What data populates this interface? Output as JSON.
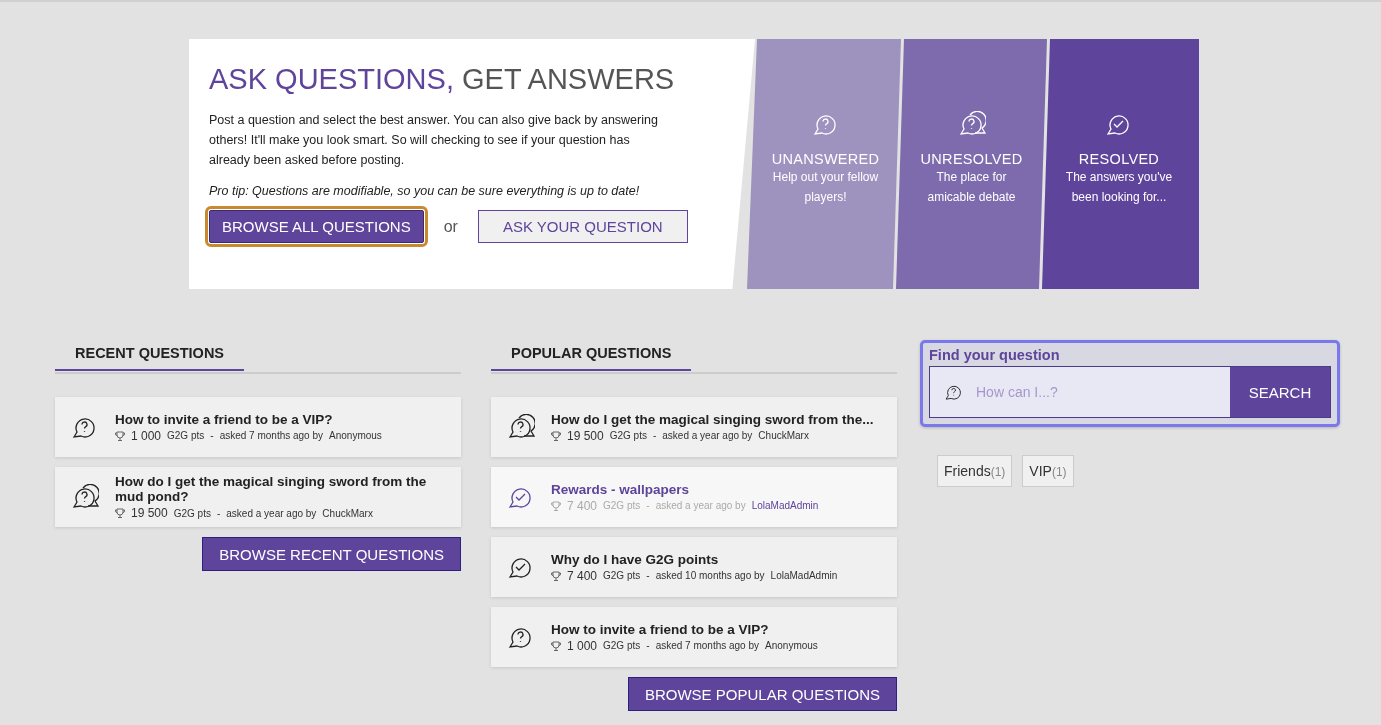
{
  "hero": {
    "title_accent": "ASK QUESTIONS,",
    "title_rest": "GET ANSWERS",
    "description": "Post a question and select the best answer. You can also give back by answering others! It'll make you look smart. So will checking to see if your question has already been asked before posting.",
    "tip": "Pro tip: Questions are modifiable, so you can be sure everything is up to date!",
    "buttons": [
      {
        "label": "BROWSE ALL QUESTIONS",
        "kind": "primary",
        "focused": true
      },
      {
        "label": "ASK YOUR QUESTION",
        "kind": "outline",
        "focused": false
      }
    ],
    "separator": "or",
    "categories": [
      {
        "kind": "unanswered",
        "title": "UNANSWERED",
        "subtitle": "Help out your fellow players!"
      },
      {
        "kind": "unresolved",
        "title": "UNRESOLVED",
        "subtitle": "The place for amicable debate"
      },
      {
        "kind": "resolved",
        "title": "RESOLVED",
        "subtitle": "The answers you've been looking for..."
      }
    ]
  },
  "recent": {
    "heading": "RECENT QUESTIONS",
    "questions": [
      {
        "kind": "unanswered",
        "highlighted": false,
        "title": "How to invite a friend to be a VIP?",
        "points": "1 000",
        "unit": "G2G pts",
        "separator": "-",
        "asked": "asked 7 months ago by",
        "author": "Anonymous"
      },
      {
        "kind": "unresolved",
        "highlighted": false,
        "title": "How do I get the magical singing sword from the mud pond?",
        "points": "19 500",
        "unit": "G2G pts",
        "separator": "-",
        "asked": "asked a year ago by",
        "author": "ChuckMarx"
      }
    ],
    "browse": "BROWSE RECENT QUESTIONS"
  },
  "popular": {
    "heading": "POPULAR QUESTIONS",
    "questions": [
      {
        "kind": "unresolved",
        "highlighted": false,
        "title": "How do I get the magical singing sword from the...",
        "points": "19 500",
        "unit": "G2G pts",
        "separator": "-",
        "asked": "asked a year ago by",
        "author": "ChuckMarx"
      },
      {
        "kind": "resolved",
        "highlighted": true,
        "title": "Rewards - wallpapers",
        "points": "7 400",
        "unit": "G2G pts",
        "separator": "-",
        "asked": "asked a year ago by",
        "author": "LolaMadAdmin"
      },
      {
        "kind": "resolved",
        "highlighted": false,
        "title": "Why do I have G2G points",
        "points": "7 400",
        "unit": "G2G pts",
        "separator": "-",
        "asked": "asked 10 months ago by",
        "author": "LolaMadAdmin"
      },
      {
        "kind": "unanswered",
        "highlighted": false,
        "title": "How to invite a friend to be a VIP?",
        "points": "1 000",
        "unit": "G2G pts",
        "separator": "-",
        "asked": "asked 7 months ago by",
        "author": "Anonymous"
      }
    ],
    "browse": "BROWSE POPULAR QUESTIONS"
  },
  "search": {
    "label": "Find your question",
    "placeholder": "How can I...?",
    "button": "SEARCH",
    "focused": true
  },
  "tags": [
    {
      "label": "Friends",
      "count": "(1)"
    },
    {
      "label": "VIP",
      "count": "(1)"
    }
  ]
}
